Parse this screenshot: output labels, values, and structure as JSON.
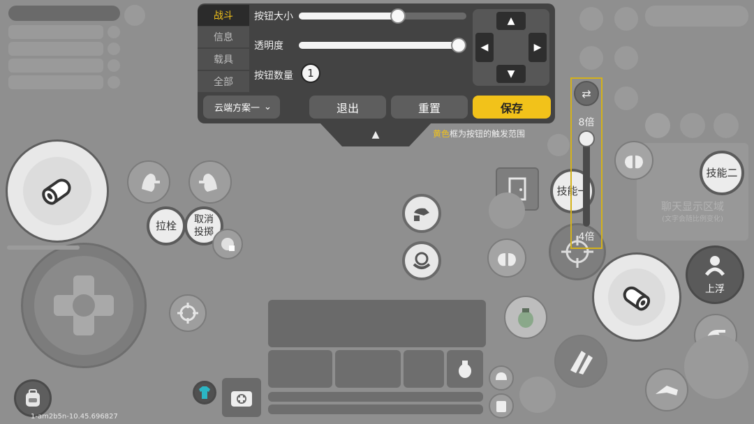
{
  "panel": {
    "tabs": [
      "战斗",
      "信息",
      "载具",
      "全部"
    ],
    "active_tab": "战斗",
    "rows": {
      "size_label": "按钮大小",
      "size_value": 0.6,
      "opacity_label": "透明度",
      "opacity_value": 1.0,
      "count_label": "按钮数量",
      "count_value": "1"
    },
    "scheme_label": "云端方案一",
    "exit_label": "退出",
    "reset_label": "重置",
    "save_label": "保存",
    "hint_highlight": "黄色",
    "hint_rest": "框为按钮的触发范围",
    "colors": {
      "accent": "#f2c21a",
      "panel_bg": "#434343"
    }
  },
  "zoom": {
    "top_label": "8倍",
    "bottom_label": "4倍"
  },
  "buttons": {
    "bolt": "拉栓",
    "cancel_throw": "取消\n投掷",
    "skill_one": "技能一",
    "skill_two": "技能二",
    "float_up": "上浮"
  },
  "chat": {
    "title": "聊天显示区域",
    "subtitle": "(文字会随比例变化)"
  },
  "version": "1-am2b5n-10.45.696827"
}
